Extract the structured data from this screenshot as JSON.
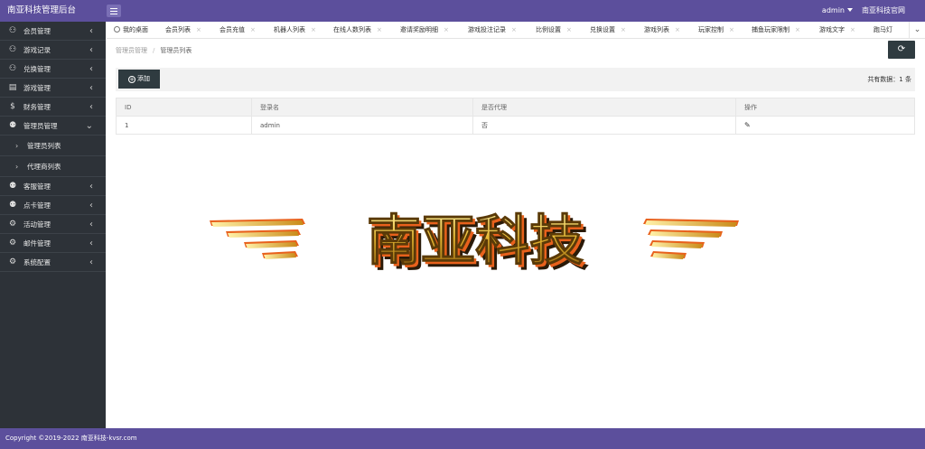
{
  "header": {
    "brand": "南亚科技管理后台",
    "user": "admin",
    "site_link": "南亚科技官网"
  },
  "sidebar": {
    "items": [
      {
        "label": "会员管理",
        "icon": "user-icon"
      },
      {
        "label": "游戏记录",
        "icon": "user-icon"
      },
      {
        "label": "兑换管理",
        "icon": "user-icon"
      },
      {
        "label": "游戏管理",
        "icon": "calendar-icon"
      },
      {
        "label": "财务管理",
        "icon": "dollar-icon"
      },
      {
        "label": "管理员管理",
        "icon": "users-icon",
        "expanded": true
      }
    ],
    "subitems": [
      {
        "label": "管理员列表"
      },
      {
        "label": "代理商列表"
      }
    ],
    "items_after": [
      {
        "label": "客服管理",
        "icon": "users-icon"
      },
      {
        "label": "点卡管理",
        "icon": "users-icon"
      },
      {
        "label": "活动管理",
        "icon": "settings-icon"
      },
      {
        "label": "邮件管理",
        "icon": "settings-icon"
      },
      {
        "label": "系统配置",
        "icon": "settings-icon"
      }
    ]
  },
  "tabs": [
    {
      "label": "我的桌面"
    },
    {
      "label": "会员列表"
    },
    {
      "label": "会员充值"
    },
    {
      "label": "机器人列表"
    },
    {
      "label": "在线人数列表"
    },
    {
      "label": "邀请奖励明细"
    },
    {
      "label": "游戏投注记录"
    },
    {
      "label": "比例设置"
    },
    {
      "label": "兑换设置"
    },
    {
      "label": "游戏列表"
    },
    {
      "label": "玩家控制"
    },
    {
      "label": "捕鱼玩家限制"
    },
    {
      "label": "游戏文字"
    },
    {
      "label": "跑马灯"
    }
  ],
  "breadcrumb": {
    "parent": "管理员管理",
    "current": "管理员列表"
  },
  "toolbar": {
    "add_label": "添加",
    "total_label": "共有数据：1 条"
  },
  "table": {
    "columns": [
      "ID",
      "登录名",
      "是否代理",
      "操作"
    ],
    "rows": [
      {
        "id": "1",
        "login": "admin",
        "is_agent": "否"
      }
    ]
  },
  "banner": {
    "text": "南亚科技"
  },
  "footer": {
    "copyright": "Copyright ©2019-2022 南亚科技-kvsr.com"
  },
  "colors": {
    "header": "#5c4f9c",
    "sidebar": "#2d3238",
    "button_dark": "#2f3b40"
  }
}
